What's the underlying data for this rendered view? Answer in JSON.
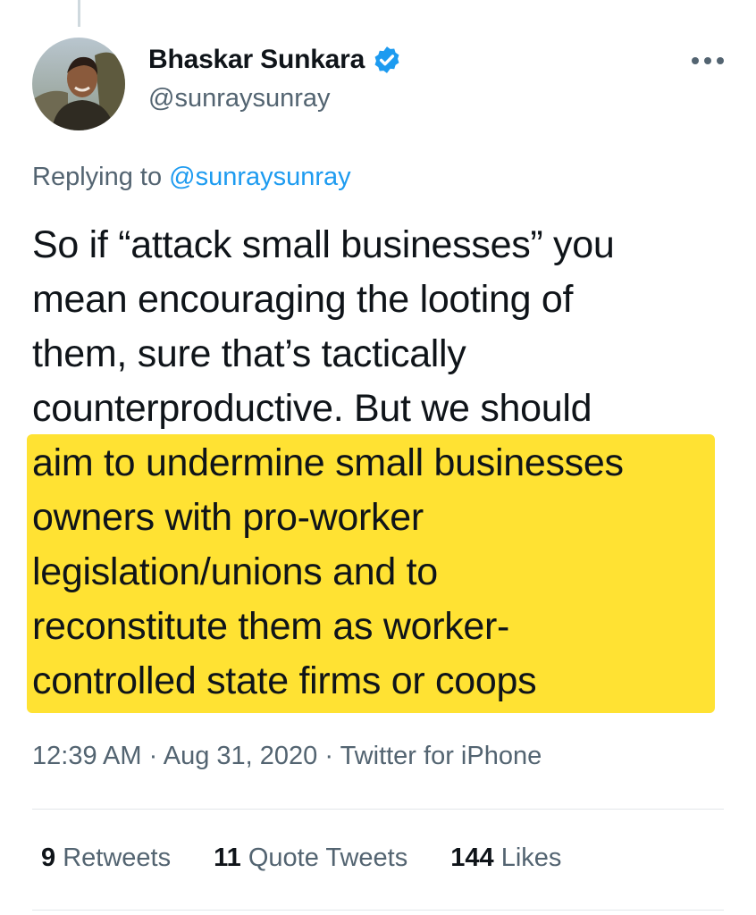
{
  "author": {
    "display_name": "Bhaskar Sunkara",
    "handle": "@sunraysunray",
    "avatar_icon": "profile-photo",
    "verified_icon": "verified-badge-icon"
  },
  "reply_context": {
    "prefix": "Replying to",
    "mention": "@sunraysunray"
  },
  "tweet": {
    "lines": [
      "So if “attack small businesses” you",
      "mean encouraging the looting of",
      "them, sure that’s tactically",
      "counterproductive. But we should",
      "aim to undermine small businesses",
      "owners with pro-worker",
      "legislation/unions and to",
      "reconstitute them as worker-",
      "controlled state firms or coops"
    ],
    "highlight_color": "#ffe233"
  },
  "meta": {
    "time": "12:39 AM",
    "date": "Aug 31, 2020",
    "source": "Twitter for iPhone",
    "separator": "·"
  },
  "stats": {
    "retweets_count": "9",
    "retweets_label": "Retweets",
    "quotes_count": "11",
    "quotes_label": "Quote Tweets",
    "likes_count": "144",
    "likes_label": "Likes"
  },
  "colors": {
    "accent": "#1d9bf0",
    "secondary_text": "#536471",
    "highlight": "#ffe233"
  }
}
